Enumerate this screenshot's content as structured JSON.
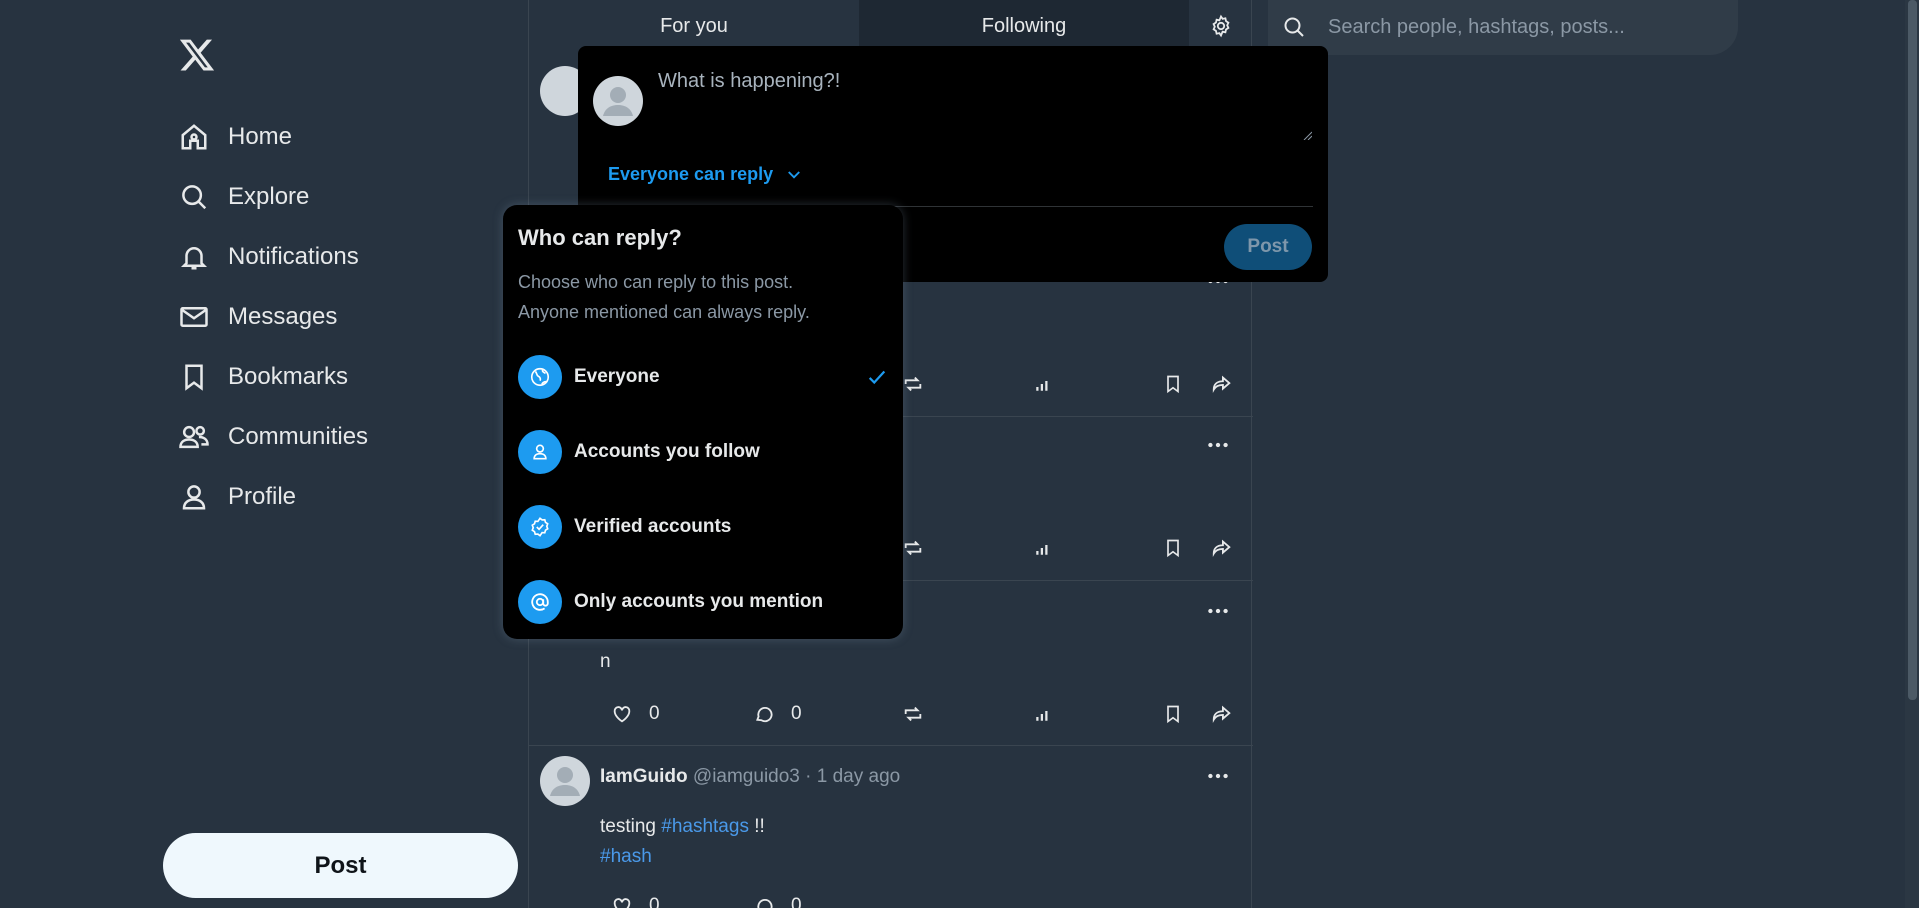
{
  "sidebar": {
    "logo_icon": "x-logo-icon",
    "items": [
      {
        "label": "Home",
        "icon": "home-icon"
      },
      {
        "label": "Explore",
        "icon": "search-icon"
      },
      {
        "label": "Notifications",
        "icon": "bell-icon"
      },
      {
        "label": "Messages",
        "icon": "envelope-icon"
      },
      {
        "label": "Bookmarks",
        "icon": "bookmark-icon"
      },
      {
        "label": "Communities",
        "icon": "people-icon"
      },
      {
        "label": "Profile",
        "icon": "person-icon"
      }
    ],
    "post_label": "Post"
  },
  "tabs": [
    {
      "label": "For you"
    },
    {
      "label": "Following",
      "selected": true
    }
  ],
  "search": {
    "placeholder": "Search people, hashtags, posts..."
  },
  "composer": {
    "placeholder": "What is happening?!",
    "reply_setting": "Everyone can reply",
    "post_label": "Post"
  },
  "reply_dropdown": {
    "title": "Who can reply?",
    "description_line1": "Choose who can reply to this post.",
    "description_line2": "Anyone mentioned can always reply.",
    "options": [
      {
        "label": "Everyone",
        "icon": "globe-icon",
        "selected": true
      },
      {
        "label": "Accounts you follow",
        "icon": "person-icon"
      },
      {
        "label": "Verified accounts",
        "icon": "verified-badge-icon"
      },
      {
        "label": "Only accounts you mention",
        "icon": "at-sign-icon"
      }
    ]
  },
  "feed": {
    "post3": {
      "text": "n",
      "likes": "0",
      "replies": "0"
    },
    "post4": {
      "name": "IamGuido",
      "handle": "@iamguido3",
      "separator": "·",
      "time": "1 day ago",
      "text_prefix": "testing",
      "hashtag1": "#hashtags",
      "text_suffix": "!!",
      "hashtag2": "#hash",
      "likes": "0",
      "replies": "0"
    }
  },
  "colors": {
    "background": "#273340",
    "accent": "#1d9bf0",
    "hashtag": "#4a99e9",
    "modal": "#000000"
  }
}
